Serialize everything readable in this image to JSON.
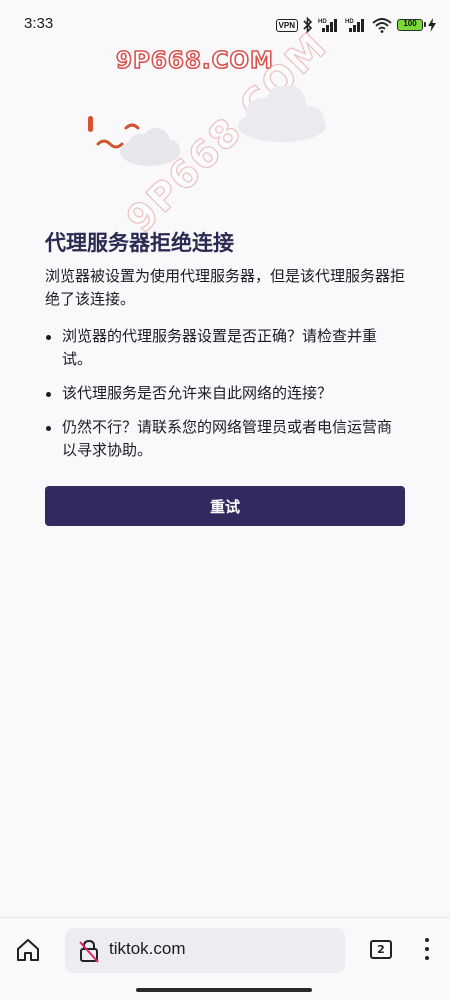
{
  "status_bar": {
    "time": "3:33",
    "vpn": "VPN",
    "battery": "100",
    "signal_label_1": "HD",
    "signal_label_2": "HD"
  },
  "watermark": {
    "top": "9P668.COM",
    "diagonal": "9P668.COM"
  },
  "error_page": {
    "title": "代理服务器拒绝连接",
    "intro": "浏览器被设置为使用代理服务器，但是该代理服务器拒绝了该连接。",
    "bullets": [
      "浏览器的代理服务器设置是否正确？请检查并重试。",
      "该代理服务是否允许来自此网络的连接？",
      "仍然不行？请联系您的网络管理员或者电信运营商以寻求协助。"
    ],
    "retry_label": "重试"
  },
  "toolbar": {
    "url": "tiktok.com",
    "tab_count": "2"
  },
  "colors": {
    "accent": "#312a5f",
    "title": "#2b2a51",
    "background": "#f9f8fb"
  },
  "icons": [
    "home-icon",
    "insecure-lock-icon",
    "tabs-icon",
    "more-menu-icon",
    "bluetooth-icon",
    "wifi-icon",
    "charging-icon"
  ]
}
